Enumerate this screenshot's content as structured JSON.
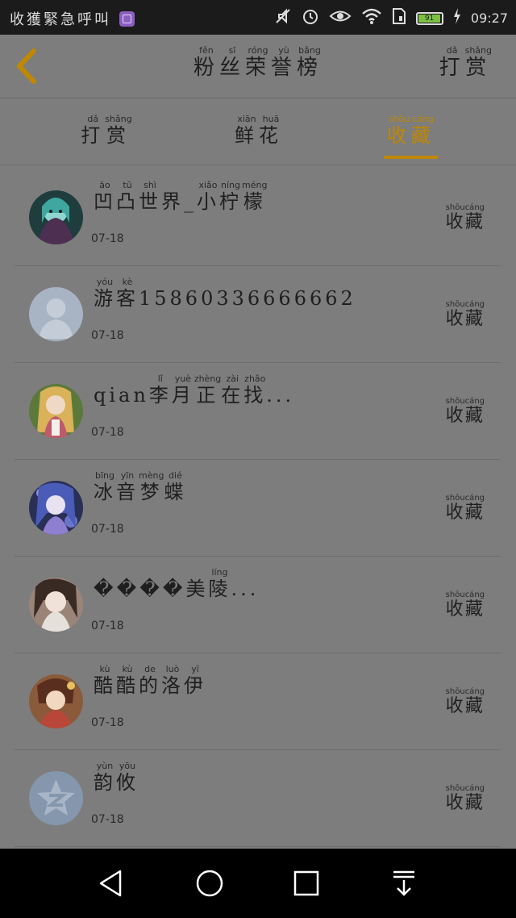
{
  "status_bar": {
    "left_text": "收獲緊急呼叫",
    "time": "09:27",
    "battery_level": "91",
    "icons": [
      "gallery-icon",
      "mute-icon",
      "alarm-icon",
      "eye-icon",
      "wifi-icon",
      "sim-icon",
      "battery-icon",
      "charging-icon"
    ]
  },
  "header": {
    "back_icon": "chevron-left-icon",
    "title": [
      {
        "ch": "粉",
        "py": "fěn"
      },
      {
        "ch": "丝",
        "py": "sī"
      },
      {
        "ch": "荣",
        "py": "róng"
      },
      {
        "ch": "誉",
        "py": "yù"
      },
      {
        "ch": "榜",
        "py": "bǎng"
      }
    ],
    "right_link": [
      {
        "ch": "打",
        "py": "dǎ"
      },
      {
        "ch": "赏",
        "py": "shǎng"
      }
    ]
  },
  "tabs": [
    {
      "active": false,
      "chars": [
        {
          "ch": "打",
          "py": "dǎ"
        },
        {
          "ch": "赏",
          "py": "shǎng"
        }
      ]
    },
    {
      "active": false,
      "chars": [
        {
          "ch": "鲜",
          "py": "xiān"
        },
        {
          "ch": "花",
          "py": "huā"
        }
      ]
    },
    {
      "active": true,
      "chars": [
        {
          "ch": "收",
          "py": "shōu"
        },
        {
          "ch": "藏",
          "py": "cáng"
        }
      ]
    }
  ],
  "colors": {
    "accent": "#c08700",
    "overlay_bg": "#7d7d7d",
    "status_bar_bg": "#1b1b1b",
    "nav_bar_bg": "#000000"
  },
  "list": [
    {
      "name": [
        {
          "ch": "凹",
          "py": "āo"
        },
        {
          "ch": "凸",
          "py": "tū"
        },
        {
          "ch": "世",
          "py": "shì"
        },
        {
          "ch": "界",
          "py": ""
        },
        {
          "ch": "_",
          "py": ""
        },
        {
          "ch": "小",
          "py": "xiǎo"
        },
        {
          "ch": "柠",
          "py": "níng"
        },
        {
          "ch": "檬",
          "py": "méng"
        }
      ],
      "date": "07-18",
      "action": [
        {
          "ch": "收",
          "py": "shōu"
        },
        {
          "ch": "藏",
          "py": "cáng"
        }
      ],
      "avatar": "anime-avatar"
    },
    {
      "name": [
        {
          "ch": "游",
          "py": "yóu"
        },
        {
          "ch": "客",
          "py": "kè"
        },
        {
          "ch": "15860336666662",
          "py": ""
        }
      ],
      "date": "07-18",
      "action": [
        {
          "ch": "收",
          "py": "shōu"
        },
        {
          "ch": "藏",
          "py": "cáng"
        }
      ],
      "avatar": "default-user-avatar"
    },
    {
      "name": [
        {
          "ch": "qian",
          "py": ""
        },
        {
          "ch": "李",
          "py": "lǐ"
        },
        {
          "ch": "月",
          "py": "yuè"
        },
        {
          "ch": "正",
          "py": "zhèng"
        },
        {
          "ch": "在",
          "py": "zài"
        },
        {
          "ch": "找",
          "py": "zhǎo"
        },
        {
          "ch": "...",
          "py": ""
        }
      ],
      "date": "07-18",
      "action": [
        {
          "ch": "收",
          "py": "shōu"
        },
        {
          "ch": "藏",
          "py": "cáng"
        }
      ],
      "avatar": "anime-avatar"
    },
    {
      "name": [
        {
          "ch": "冰",
          "py": "bīng"
        },
        {
          "ch": "音",
          "py": "yīn"
        },
        {
          "ch": "梦",
          "py": "mèng"
        },
        {
          "ch": "蝶",
          "py": "dié"
        }
      ],
      "date": "07-18",
      "action": [
        {
          "ch": "收",
          "py": "shōu"
        },
        {
          "ch": "藏",
          "py": "cáng"
        }
      ],
      "avatar": "anime-avatar"
    },
    {
      "name": [
        {
          "ch": "����",
          "py": ""
        },
        {
          "ch": "美",
          "py": ""
        },
        {
          "ch": "陵",
          "py": "líng"
        },
        {
          "ch": "...",
          "py": ""
        }
      ],
      "date": "07-18",
      "action": [
        {
          "ch": "收",
          "py": "shōu"
        },
        {
          "ch": "藏",
          "py": "cáng"
        }
      ],
      "avatar": "anime-avatar"
    },
    {
      "name": [
        {
          "ch": "酷",
          "py": "kù"
        },
        {
          "ch": "酷",
          "py": "kù"
        },
        {
          "ch": "的",
          "py": "de"
        },
        {
          "ch": "洛",
          "py": "luò"
        },
        {
          "ch": "伊",
          "py": "yī"
        }
      ],
      "date": "07-18",
      "action": [
        {
          "ch": "收",
          "py": "shōu"
        },
        {
          "ch": "藏",
          "py": "cáng"
        }
      ],
      "avatar": "anime-avatar"
    },
    {
      "name": [
        {
          "ch": "韵",
          "py": "yùn"
        },
        {
          "ch": "攸",
          "py": "yōu"
        }
      ],
      "date": "07-18",
      "action": [
        {
          "ch": "收",
          "py": "shōu"
        },
        {
          "ch": "藏",
          "py": "cáng"
        }
      ],
      "avatar": "qq-star-avatar"
    }
  ],
  "nav_bar": {
    "icons": [
      "back-triangle-icon",
      "home-circle-icon",
      "recents-square-icon",
      "notification-pull-icon"
    ]
  }
}
